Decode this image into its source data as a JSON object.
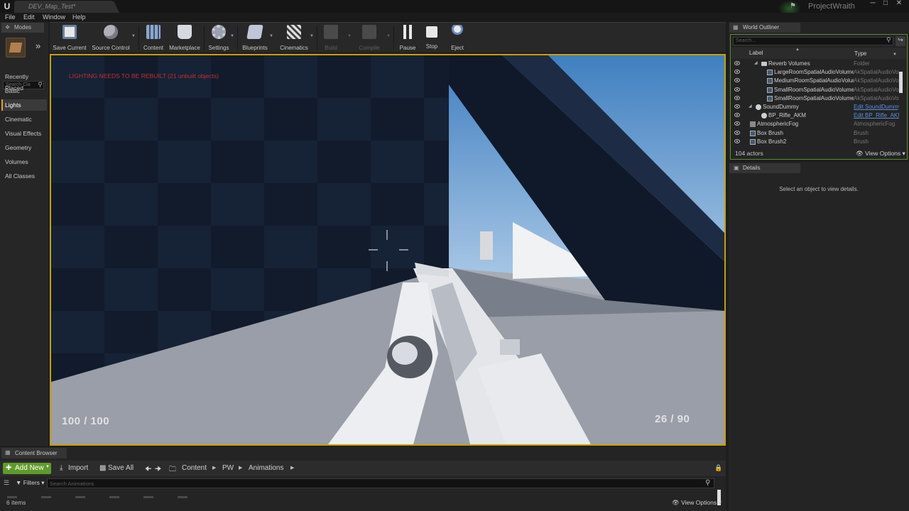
{
  "titlebar": {
    "tab_title": "DEV_Map_Test*",
    "project_name": "ProjectWraith",
    "logo": "U"
  },
  "menu": [
    "File",
    "Edit",
    "Window",
    "Help"
  ],
  "modes": {
    "tab_label": "Modes",
    "search_placeholder": "Search Cla",
    "categories": [
      "Recently Placed",
      "Basic",
      "Lights",
      "Cinematic",
      "Visual Effects",
      "Geometry",
      "Volumes",
      "All Classes"
    ],
    "active_category": "Lights"
  },
  "toolbar": {
    "buttons": [
      {
        "label": "Save Current",
        "icon": "save-icon",
        "enabled": true
      },
      {
        "label": "Source Control",
        "icon": "source-control-icon",
        "enabled": true
      },
      {
        "label": "Content",
        "icon": "content-icon",
        "enabled": true
      },
      {
        "label": "Marketplace",
        "icon": "marketplace-icon",
        "enabled": true
      },
      {
        "label": "Settings",
        "icon": "settings-icon",
        "enabled": true
      },
      {
        "label": "Blueprints",
        "icon": "blueprints-icon",
        "enabled": true
      },
      {
        "label": "Cinematics",
        "icon": "cinematics-icon",
        "enabled": true
      },
      {
        "label": "Build",
        "icon": "build-icon",
        "enabled": false
      },
      {
        "label": "Compile",
        "icon": "compile-icon",
        "enabled": false
      },
      {
        "label": "Pause",
        "icon": "pause-icon",
        "enabled": true
      },
      {
        "label": "Stop",
        "icon": "stop-icon",
        "enabled": true
      },
      {
        "label": "Eject",
        "icon": "eject-icon",
        "enabled": true
      }
    ]
  },
  "viewport": {
    "warning": "LIGHTING NEEDS TO BE REBUILT (21 unbuilt objects)",
    "health": "100  /  100",
    "ammo": "26  /  90",
    "warning_color": "#c23030"
  },
  "outliner": {
    "tab_label": "World Outliner",
    "search_placeholder": "Search...",
    "col_label": "Label",
    "col_type": "Type",
    "rows": [
      {
        "label": "Reverb Volumes",
        "type": "Folder",
        "icon": "folder-icon",
        "link": false
      },
      {
        "label": "LargeRoomSpatialAudioVolume",
        "type": "AkSpatialAudioVolume",
        "icon": "volume-icon",
        "link": false
      },
      {
        "label": "MediumRoomSpatialAudioVolume",
        "type": "AkSpatialAudioVolume",
        "icon": "volume-icon",
        "link": false
      },
      {
        "label": "SmallRoomSpatialAudioVolume",
        "type": "AkSpatialAudioVolume",
        "icon": "volume-icon",
        "link": false
      },
      {
        "label": "SmallRoomSpatialAudioVolume",
        "type": "AkSpatialAudioVolume",
        "icon": "volume-icon",
        "link": false
      },
      {
        "label": "SoundDummy",
        "type": "Edit SoundDummy",
        "icon": "sphere-icon",
        "link": true
      },
      {
        "label": "BP_Rifle_AKM",
        "type": "Edit BP_Rifle_AKM",
        "icon": "sphere-icon",
        "link": true
      },
      {
        "label": "AtmosphericFog",
        "type": "AtmosphericFog",
        "icon": "fog-icon",
        "link": false
      },
      {
        "label": "Box Brush",
        "type": "Brush",
        "icon": "brush-icon",
        "link": false
      },
      {
        "label": "Box Brush2",
        "type": "Brush",
        "icon": "brush-icon",
        "link": false
      }
    ],
    "actor_count": "104 actors",
    "view_options": "View Options"
  },
  "details": {
    "tab_label": "Details",
    "hint": "Select an object to view details."
  },
  "content_browser": {
    "tab_label": "Content Browser",
    "add_new": "Add New",
    "import": "Import",
    "save_all": "Save All",
    "path": [
      "Content",
      "PW",
      "Animations"
    ],
    "filters": "Filters",
    "search_placeholder": "Search Animations",
    "item_count": "6 items",
    "view_options": "View Options"
  },
  "colors": {
    "accent": "#c7a000",
    "add_new": "#5f9b2a",
    "link": "#5a8fd8"
  }
}
